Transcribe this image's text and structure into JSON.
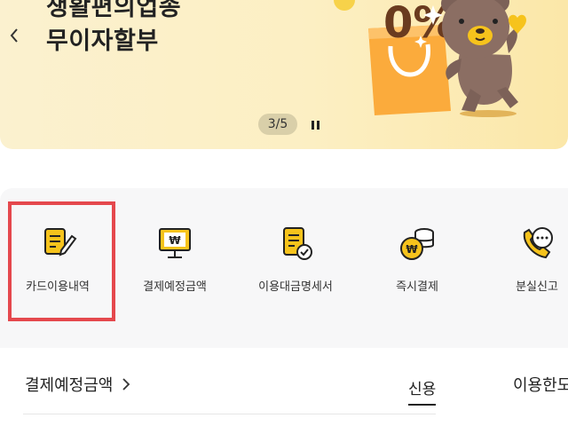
{
  "banner": {
    "title_line1": "생활편의업종",
    "title_line2": "무이자할부",
    "pager": "3/5",
    "art_text": "0%"
  },
  "quick_menu": {
    "items": [
      {
        "label": "카드이용내역",
        "icon": "card-history-icon"
      },
      {
        "label": "결제예정금액",
        "icon": "won-monitor-icon"
      },
      {
        "label": "이용대금명세서",
        "icon": "statement-icon"
      },
      {
        "label": "즉시결제",
        "icon": "coin-stack-icon"
      },
      {
        "label": "분실신고",
        "icon": "phone-call-icon"
      }
    ]
  },
  "payment": {
    "title": "결제예정금액",
    "tab_credit": "신용",
    "limit_title": "이용한도"
  },
  "colors": {
    "accent_yellow": "#f6c31c",
    "highlight_red": "#e5484d",
    "banner_bg": "#fcefc3"
  }
}
